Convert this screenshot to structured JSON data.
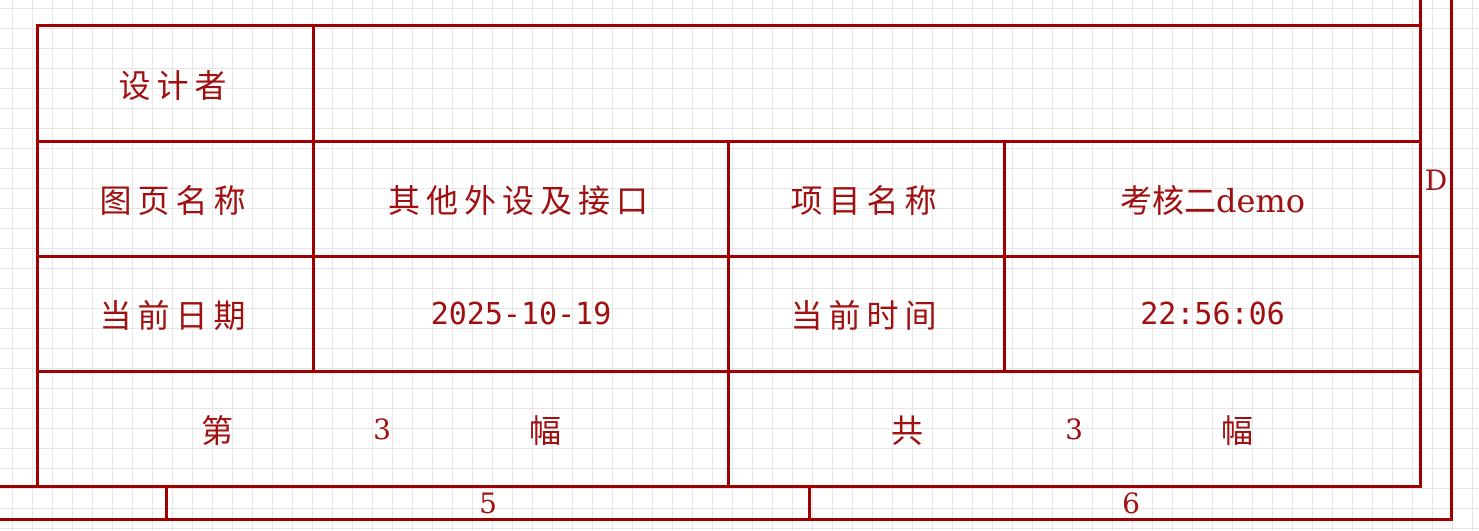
{
  "title_block": {
    "designer_label": "设计者",
    "designer_value": "",
    "sheet_name_label": "图页名称",
    "sheet_name_value": "其他外设及接口",
    "project_name_label": "项目名称",
    "project_name_value": "考核二demo",
    "date_label": "当前日期",
    "date_value": "2025-10-19",
    "time_label": "当前时间",
    "time_value": "22:56:06",
    "page_prefix": "第",
    "page_number": "3",
    "page_suffix": "幅",
    "total_prefix": "共",
    "total_number": "3",
    "total_suffix": "幅"
  },
  "border_markers": {
    "row_marker": "D",
    "col_marker_5": "5",
    "col_marker_6": "6"
  },
  "colors": {
    "line": "#a00000",
    "text": "#a01010",
    "grid": "#e6e6e6",
    "background": "#ffffff"
  }
}
